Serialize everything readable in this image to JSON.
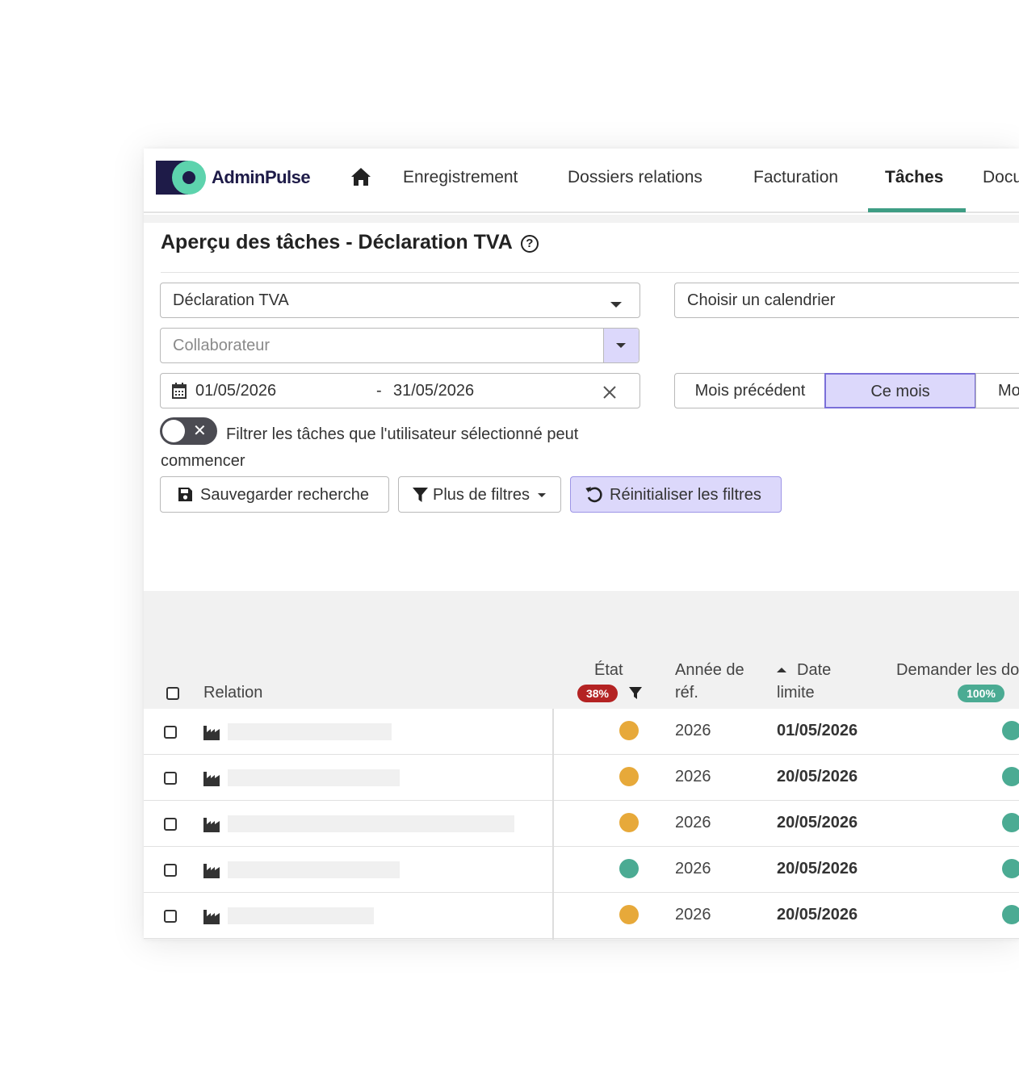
{
  "brand": {
    "name": "AdminPulse",
    "navy": "#1e1b48",
    "mint": "#5dd3ad"
  },
  "nav": {
    "home_icon": "home-icon",
    "items": [
      "Enregistrement",
      "Dossiers relations",
      "Facturation",
      "Tâches",
      "Docu"
    ],
    "active": "Tâches",
    "accent": "#3e9d84"
  },
  "page": {
    "title": "Aperçu des tâches - Déclaration TVA",
    "help_icon": "help-circle-icon"
  },
  "filters": {
    "task_type": "Déclaration TVA",
    "calendar_placeholder": "Choisir un calendrier",
    "collaborator_placeholder": "Collaborateur",
    "date_from": "01/05/2026",
    "date_sep": "-",
    "date_to": "31/05/2026",
    "period_buttons": [
      "Mois précédent",
      "Ce mois",
      "Mo"
    ],
    "period_active": "Ce mois",
    "toggle_label": "Filtrer les tâches que l'utilisateur sélectionné peut commencer",
    "toggle_on": false
  },
  "actions": {
    "save_search": "Sauvegarder recherche",
    "more_filters": "Plus de filtres",
    "reset_filters": "Réinitialiser les filtres"
  },
  "table": {
    "columns": {
      "relation": "Relation",
      "state": "État",
      "state_pct": "38%",
      "ref_year_line1": "Année de",
      "ref_year_line2": "réf.",
      "deadline_line1": "Date",
      "deadline_line2": "limite",
      "request": "Demander les do",
      "request_pct": "100%"
    },
    "status_colors": {
      "in_progress": "#e7a93a",
      "done": "#4bab93",
      "danger": "#b42323"
    },
    "rows": [
      {
        "state": "in_progress",
        "year": "2026",
        "deadline": "01/05/2026",
        "request": "done"
      },
      {
        "state": "in_progress",
        "year": "2026",
        "deadline": "20/05/2026",
        "request": "done"
      },
      {
        "state": "in_progress",
        "year": "2026",
        "deadline": "20/05/2026",
        "request": "done"
      },
      {
        "state": "done",
        "year": "2026",
        "deadline": "20/05/2026",
        "request": "done"
      },
      {
        "state": "in_progress",
        "year": "2026",
        "deadline": "20/05/2026",
        "request": "done"
      }
    ]
  }
}
